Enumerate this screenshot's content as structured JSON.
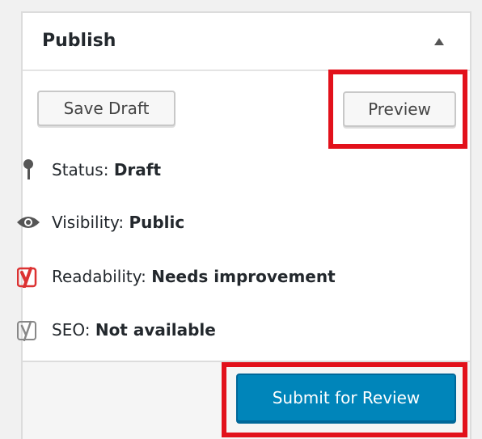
{
  "publish_box": {
    "title": "Publish",
    "toggle_icon": "arrow-up-icon",
    "save_draft_label": "Save Draft",
    "preview_label": "Preview",
    "status": {
      "label": "Status:",
      "value": "Draft",
      "icon": "pin-icon"
    },
    "visibility": {
      "label": "Visibility:",
      "value": "Public",
      "icon": "eye-icon"
    },
    "readability": {
      "label": "Readability:",
      "value": "Needs improvement",
      "icon": "yoast-icon",
      "color": "#dc3232"
    },
    "seo": {
      "label": "SEO:",
      "value": "Not available",
      "icon": "yoast-icon",
      "color": "#888888"
    },
    "submit_label": "Submit for Review"
  },
  "highlight_color": "#e2111b",
  "colors": {
    "primary": "#0085ba"
  }
}
